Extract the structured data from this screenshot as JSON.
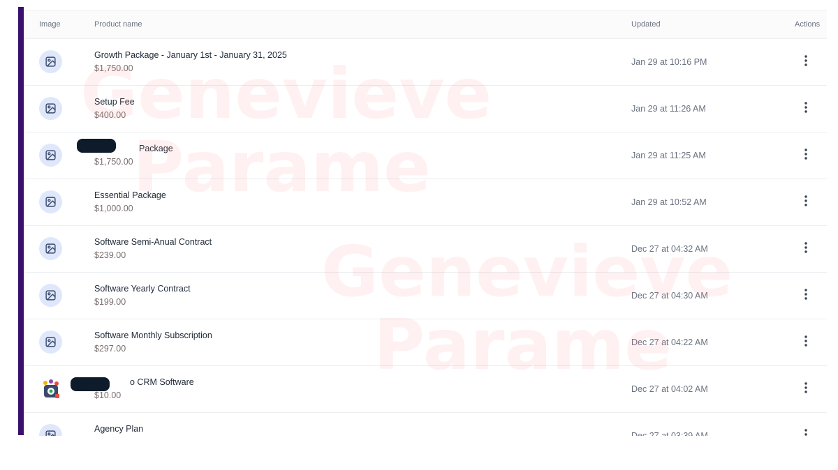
{
  "table": {
    "headers": {
      "image": "Image",
      "product_name": "Product name",
      "updated": "Updated",
      "actions": "Actions"
    },
    "rows": [
      {
        "name": "Growth Package  - January 1st - January 31, 2025",
        "price": "$1,750.00",
        "updated": "Jan 29 at 10:16 PM",
        "thumb": "image-placeholder-icon"
      },
      {
        "name": "Setup Fee",
        "price": "$400.00",
        "updated": "Jan 29 at 11:26 AM",
        "thumb": "image-placeholder-icon"
      },
      {
        "name": "Package",
        "price": "$1,750.00",
        "updated": "Jan 29 at 11:25 AM",
        "thumb": "image-placeholder-icon"
      },
      {
        "name": "Essential Package",
        "price": "$1,000.00",
        "updated": "Jan 29 at 10:52 AM",
        "thumb": "image-placeholder-icon"
      },
      {
        "name": "Software Semi-Anual Contract",
        "price": "$239.00",
        "updated": "Dec 27 at 04:32 AM",
        "thumb": "image-placeholder-icon"
      },
      {
        "name": "Software Yearly Contract",
        "price": "$199.00",
        "updated": "Dec 27 at 04:30 AM",
        "thumb": "image-placeholder-icon"
      },
      {
        "name": "Software Monthly Subscription",
        "price": "$297.00",
        "updated": "Dec 27 at 04:22 AM",
        "thumb": "image-placeholder-icon"
      },
      {
        "name": "o CRM Software",
        "price": "$10.00",
        "updated": "Dec 27 at 04:02 AM",
        "thumb": "app-logo-icon"
      },
      {
        "name": "Agency Plan",
        "price": "",
        "updated": "Dec 27 at 03:39 AM",
        "thumb": "image-placeholder-icon"
      }
    ]
  },
  "watermark": {
    "line1": "Genevieve",
    "line2": "Parame"
  },
  "colors": {
    "accent_bar": "#3b0f6e",
    "thumb_bg": "#dfe7fb",
    "thumb_icon": "#3b4a6b",
    "redaction": "#0d1b2a",
    "watermark": "#ff7878"
  }
}
